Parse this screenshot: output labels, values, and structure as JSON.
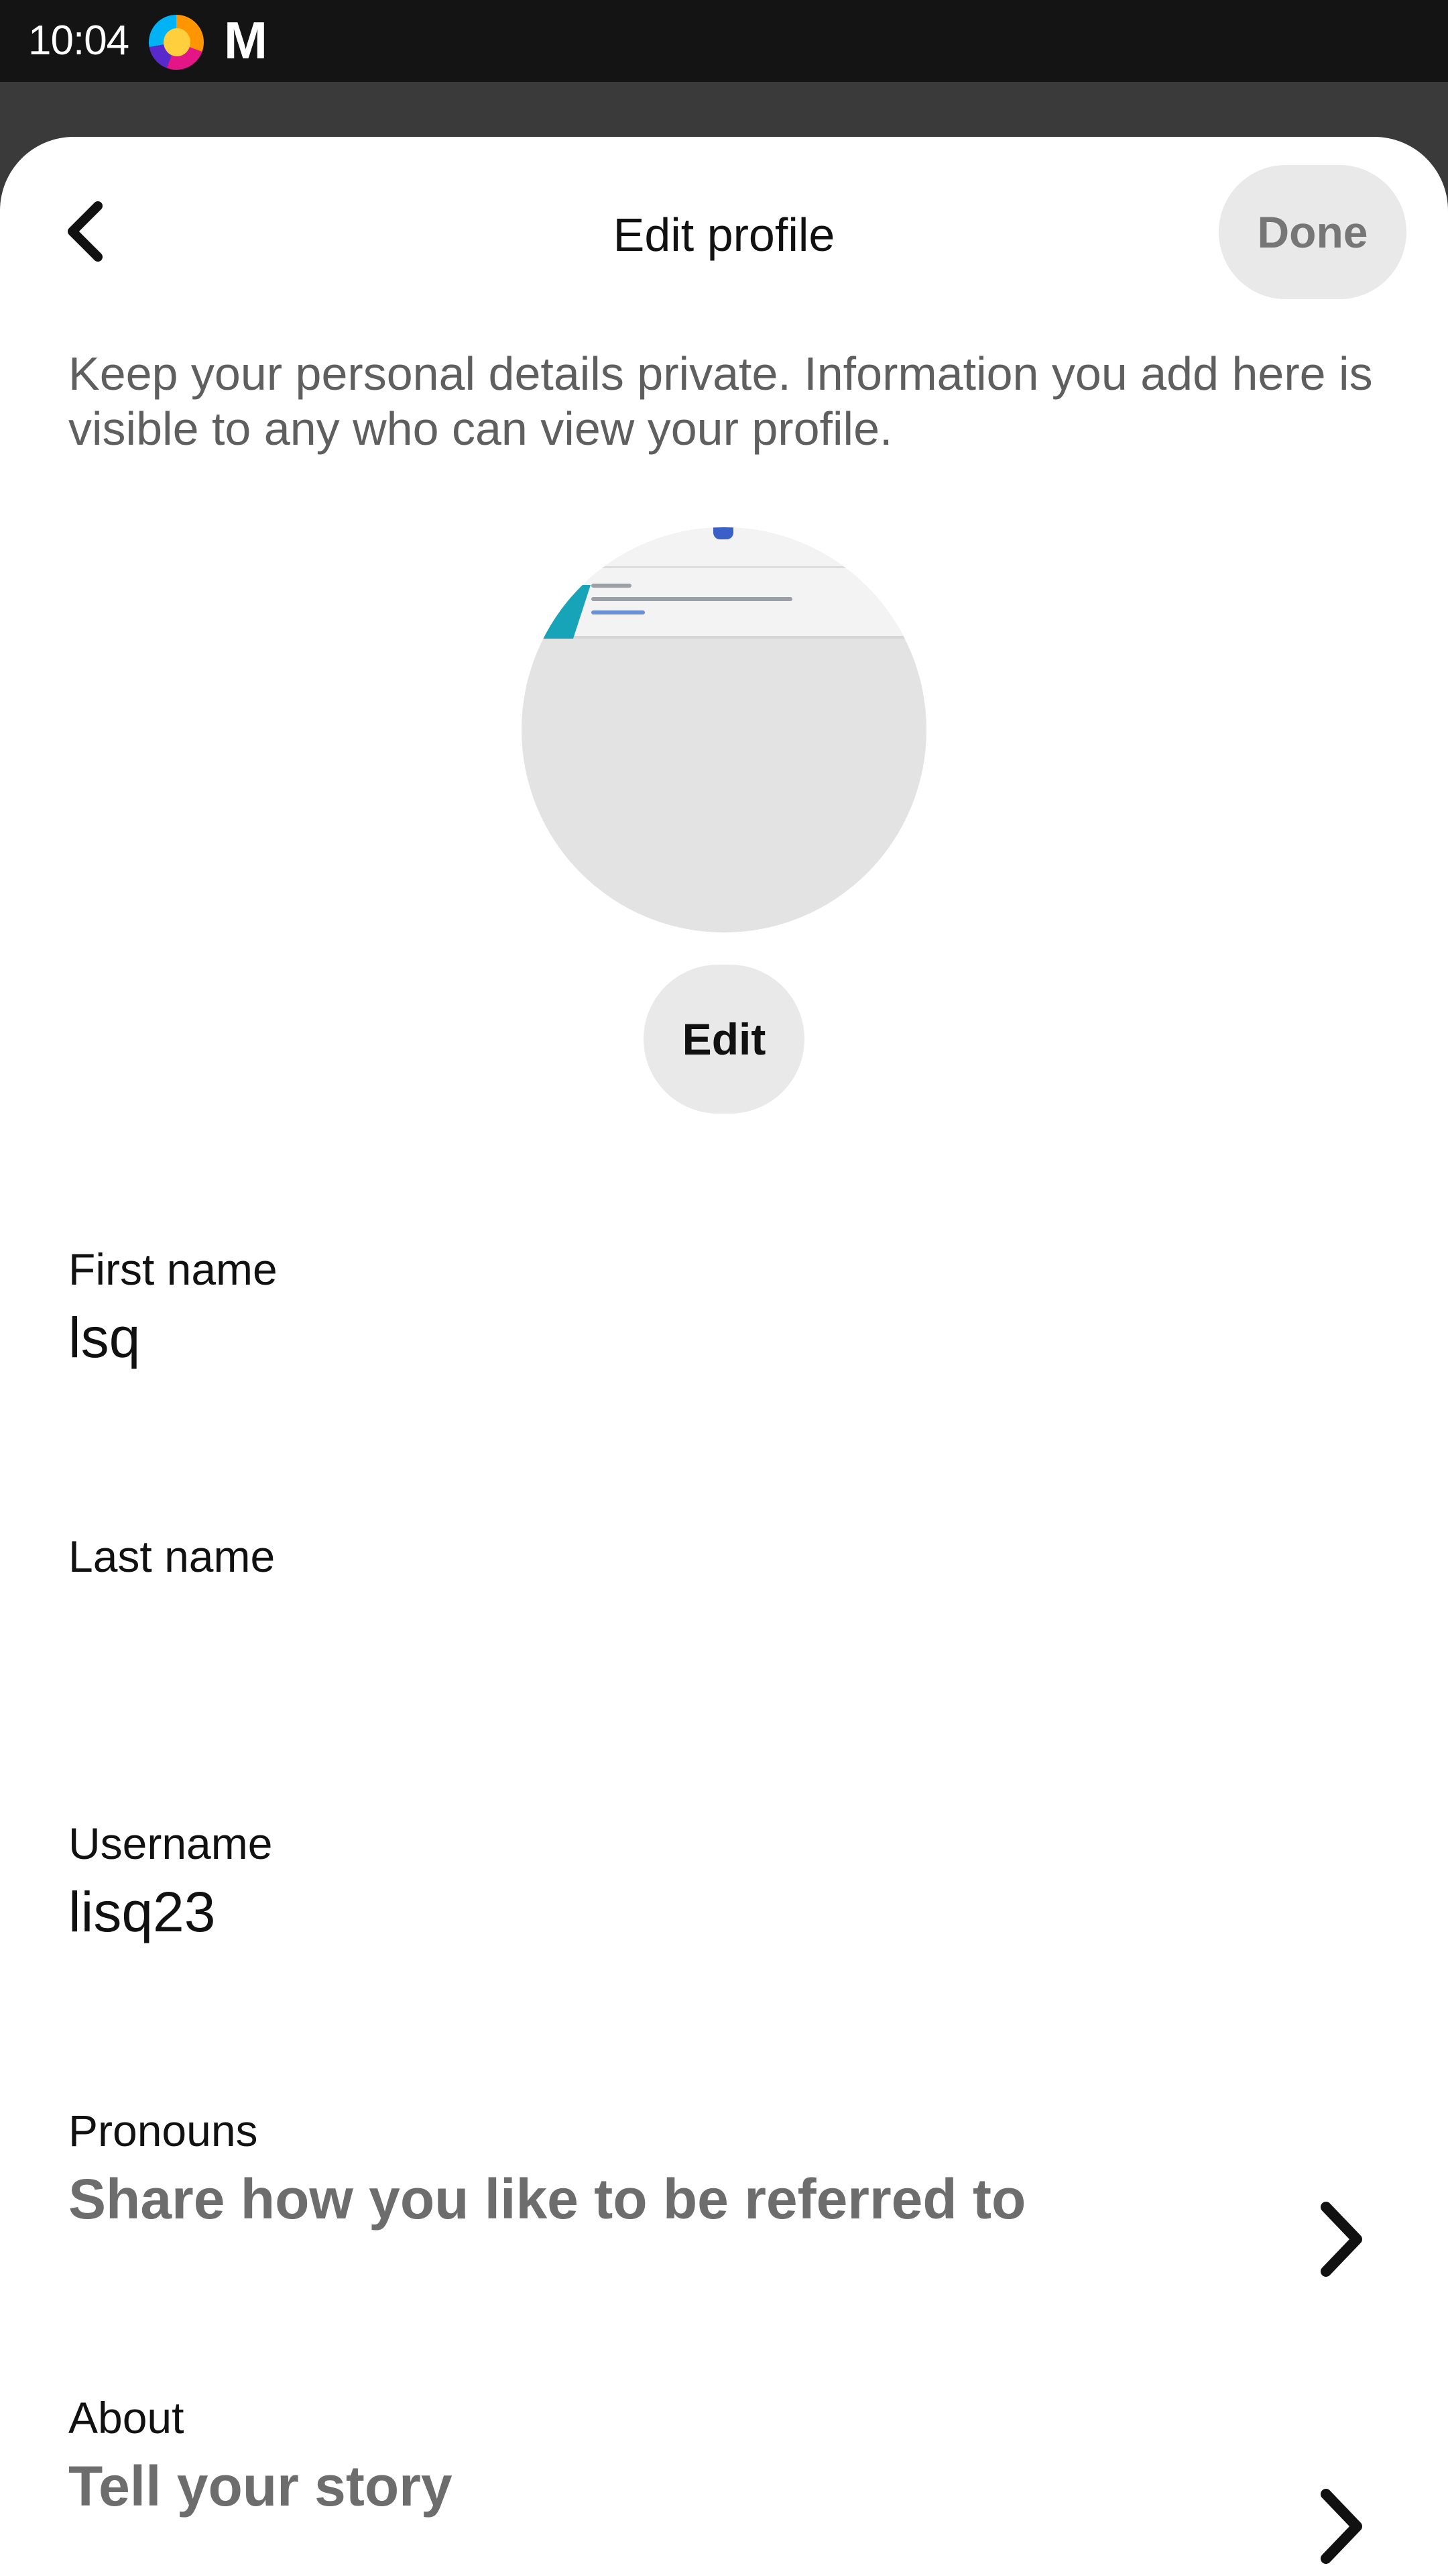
{
  "status_bar": {
    "time": "10:04",
    "icons": [
      "firefox-icon",
      "mail-m-icon"
    ]
  },
  "header": {
    "title": "Edit profile",
    "done_label": "Done",
    "back_icon": "chevron-left-icon"
  },
  "privacy_note": "Keep your personal details private. Information you add here is visible to any who can view your profile.",
  "avatar": {
    "edit_label": "Edit"
  },
  "fields": {
    "first_name": {
      "label": "First name",
      "value": "lsq"
    },
    "last_name": {
      "label": "Last name",
      "value": ""
    },
    "username": {
      "label": "Username",
      "value": "lisq23"
    },
    "pronouns": {
      "label": "Pronouns",
      "placeholder": "Share how you like to be referred to"
    },
    "about": {
      "label": "About",
      "placeholder": "Tell your story"
    }
  },
  "colors": {
    "status_bar": "#141414",
    "scrim": "#3a3a3a",
    "sheet": "#ffffff",
    "button_bg": "#e9e9e9",
    "done_text": "#767676",
    "secondary_text": "#5f5f5f",
    "placeholder_text": "#6d6d6d"
  }
}
